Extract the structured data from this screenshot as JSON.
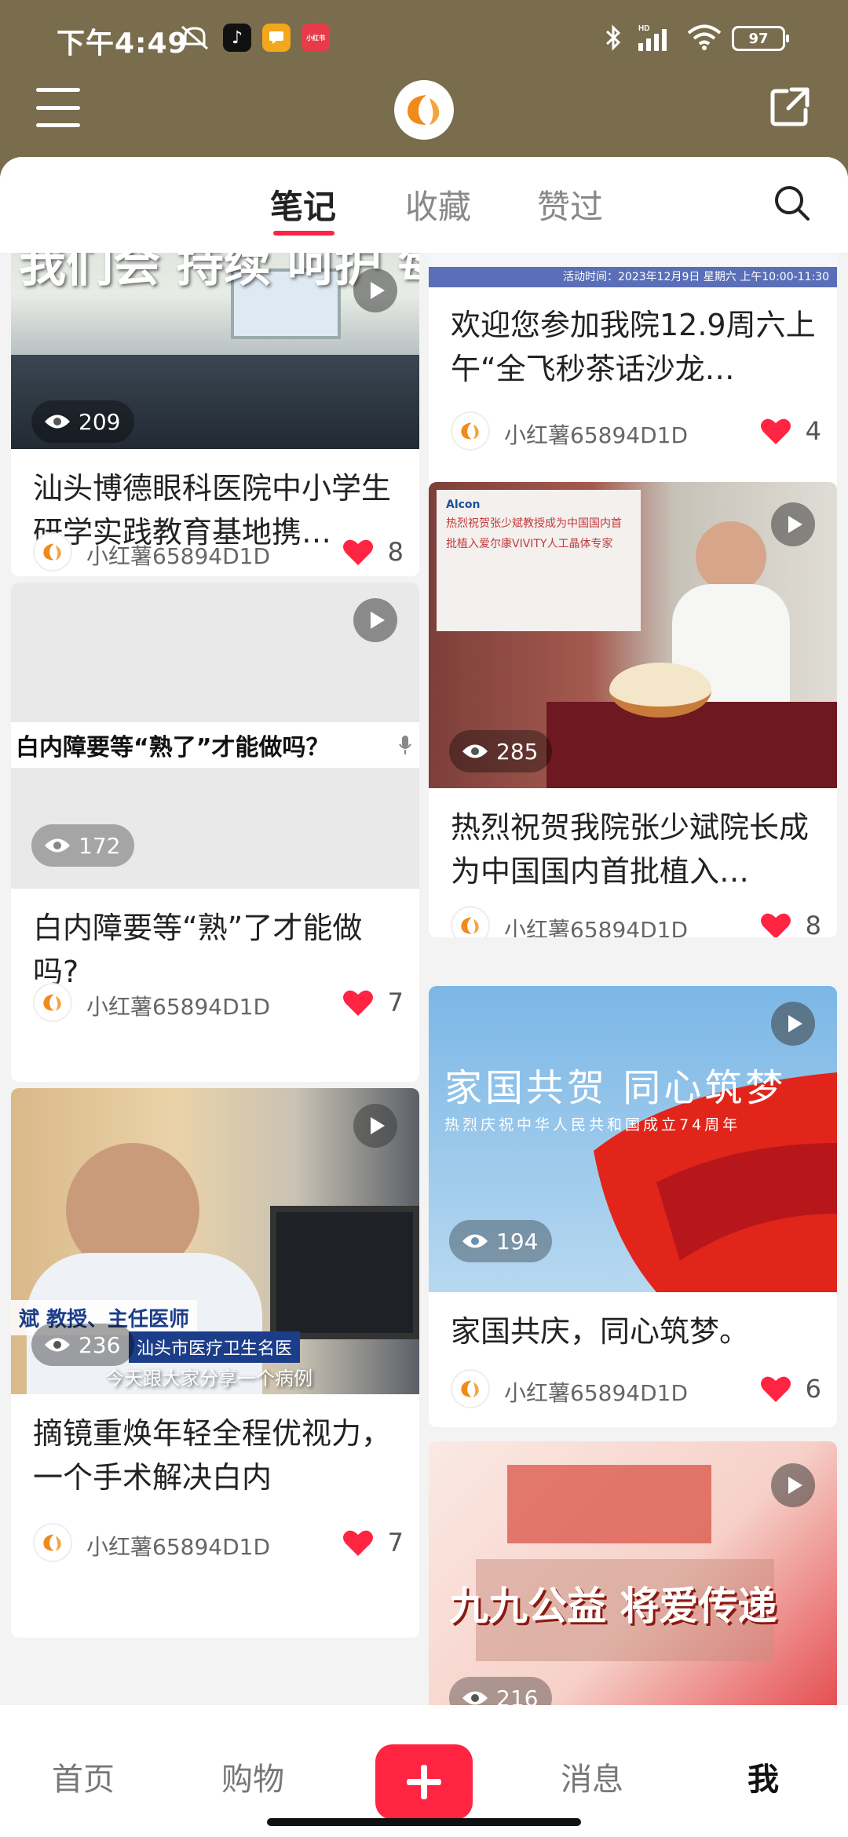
{
  "status_bar": {
    "time": "下午4:49",
    "battery": "97",
    "app3_label": "小红书",
    "signal_label": "HD"
  },
  "header": {
    "menu_icon": "menu-icon",
    "logo_icon": "croissant-logo",
    "share_icon": "share-icon"
  },
  "tabs": [
    {
      "label": "笔记",
      "active": true
    },
    {
      "label": "收藏",
      "active": false
    },
    {
      "label": "赞过",
      "active": false
    }
  ],
  "notes": [
    {
      "title": "汕头博德眼科医院中小学生研学实践教育基地携…",
      "author": "小红薯65894D1D",
      "likes": "8",
      "views": "209",
      "overlay": "我们会 持续 呵护 每个孩子的眼睛"
    },
    {
      "title": "白内障要等“熟”了才能做吗?",
      "author": "小红薯65894D1D",
      "likes": "7",
      "views": "172",
      "caption": "白内障要等“熟了”才能做吗？"
    },
    {
      "title": "摘镜重焕年轻全程优视力，一个手术解决白内",
      "author": "小红薯65894D1D",
      "likes": "7",
      "views": "236",
      "lower_third_1": "斌 教授、主任医师",
      "lower_third_2": "汕头市医疗卫生名医",
      "subtitle": "今天跟大家分享一个病例"
    },
    {
      "title": "欢迎您参加我院12.9周六上午“全飞秒茶话沙龙…",
      "author": "小红薯65894D1D",
      "likes": "4",
      "event_time": "活动时间：2023年12月9日 星期六 上午10:00-11:30"
    },
    {
      "title": "热烈祝贺我院张少斌院长成为中国国内首批植入…",
      "author": "小红薯65894D1D",
      "likes": "8",
      "views": "285",
      "screen_text": "热烈祝贺张少斌教授成为中国国内首批植入爱尔康VIVITY人工晶体专家",
      "brand": "Alcon"
    },
    {
      "title": "家国共庆，同心筑梦。",
      "author": "小红薯65894D1D",
      "likes": "6",
      "views": "194",
      "headline": "家国共贺  同心筑梦",
      "subline": "热烈庆祝中华人民共和国成立74周年"
    },
    {
      "headline": "九九公益  将爱传递",
      "views": "216"
    }
  ],
  "bottom_nav": [
    {
      "label": "首页"
    },
    {
      "label": "购物"
    },
    {
      "label": "消息"
    },
    {
      "label": "我"
    }
  ],
  "colors": {
    "header_bg": "#7a6d4e",
    "accent": "#ff2442"
  }
}
